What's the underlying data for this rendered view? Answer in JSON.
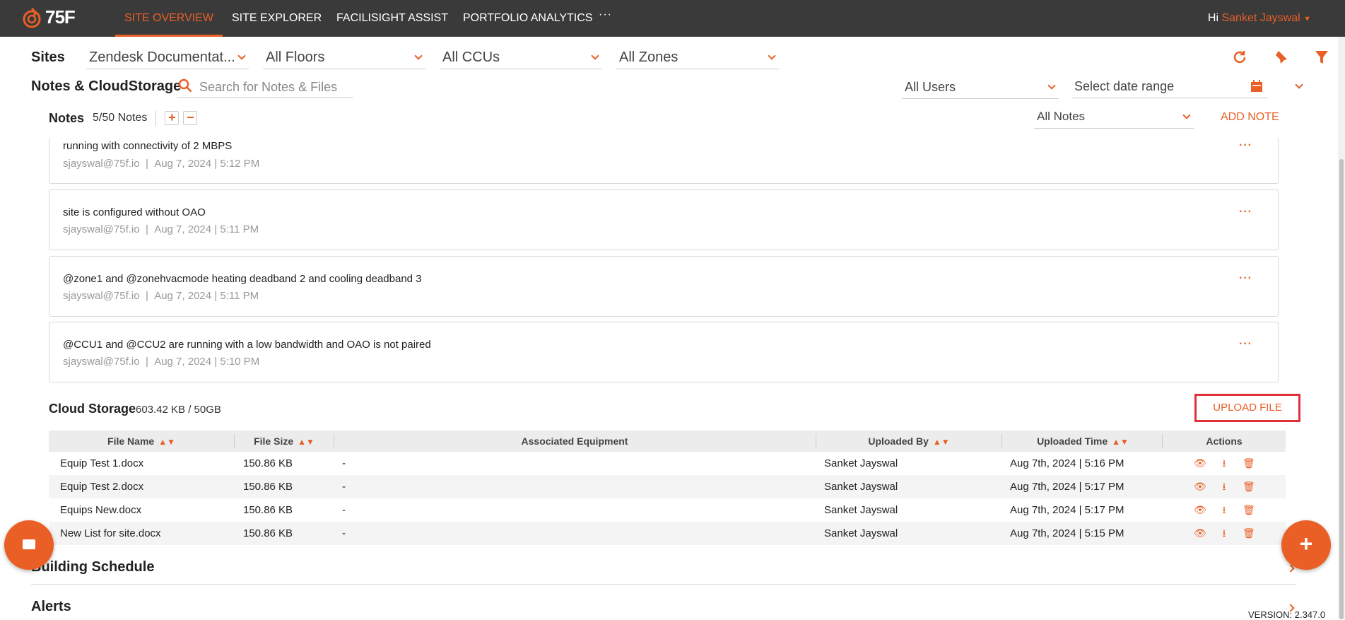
{
  "nav": {
    "logo_text": "75F",
    "tabs": [
      "SITE OVERVIEW",
      "SITE EXPLORER",
      "FACILISIGHT ASSIST",
      "PORTFOLIO ANALYTICS"
    ],
    "more": "···",
    "greeting": "Hi",
    "user": "Sanket Jayswal"
  },
  "filters": {
    "sites_label": "Sites",
    "site": "Zendesk Documentat...",
    "floors": "All Floors",
    "ccus": "All CCUs",
    "zones": "All Zones"
  },
  "notes_cloud": {
    "title": "Notes & CloudStorage",
    "search_placeholder": "Search for Notes & Files",
    "users": "All Users",
    "date_range": "Select date range"
  },
  "notes": {
    "title": "Notes",
    "count": "5/50 Notes",
    "filter": "All Notes",
    "add_label": "ADD NOTE",
    "items": [
      {
        "text": "running with connectivity of 2 MBPS",
        "author": "sjayswal@75f.io",
        "time": "Aug 7, 2024 | 5:12 PM"
      },
      {
        "text": "site is configured without OAO",
        "author": "sjayswal@75f.io",
        "time": "Aug 7, 2024 | 5:11 PM"
      },
      {
        "text": "@zone1 and @zonehvacmode heating deadband 2 and cooling deadband 3",
        "author": "sjayswal@75f.io",
        "time": "Aug 7, 2024 | 5:11 PM"
      },
      {
        "text": "@CCU1 and @CCU2 are running with a low bandwidth and OAO is not paired",
        "author": "sjayswal@75f.io",
        "time": "Aug 7, 2024 | 5:10 PM"
      }
    ]
  },
  "cloud_storage": {
    "title": "Cloud Storage",
    "usage": "603.42 KB / 50GB",
    "upload_label": "UPLOAD FILE",
    "columns": [
      "File Name",
      "File Size",
      "Associated Equipment",
      "Uploaded By",
      "Uploaded Time",
      "Actions"
    ],
    "rows": [
      {
        "name": "Equip Test 1.docx",
        "size": "150.86 KB",
        "equipment": "-",
        "by": "Sanket Jayswal",
        "time": "Aug 7th, 2024 | 5:16 PM"
      },
      {
        "name": "Equip Test 2.docx",
        "size": "150.86 KB",
        "equipment": "-",
        "by": "Sanket Jayswal",
        "time": "Aug 7th, 2024 | 5:17 PM"
      },
      {
        "name": "Equips New.docx",
        "size": "150.86 KB",
        "equipment": "-",
        "by": "Sanket Jayswal",
        "time": "Aug 7th, 2024 | 5:17 PM"
      },
      {
        "name": "New List for site.docx",
        "size": "150.86 KB",
        "equipment": "-",
        "by": "Sanket Jayswal",
        "time": "Aug 7th, 2024 | 5:15 PM"
      }
    ]
  },
  "sections": {
    "building_schedule": "Building Schedule",
    "alerts": "Alerts"
  },
  "version": "VERSION: 2.347.0",
  "colors": {
    "accent": "#e95f26",
    "nav_bg": "#3a3a3a",
    "highlight_border": "#e0303a"
  }
}
